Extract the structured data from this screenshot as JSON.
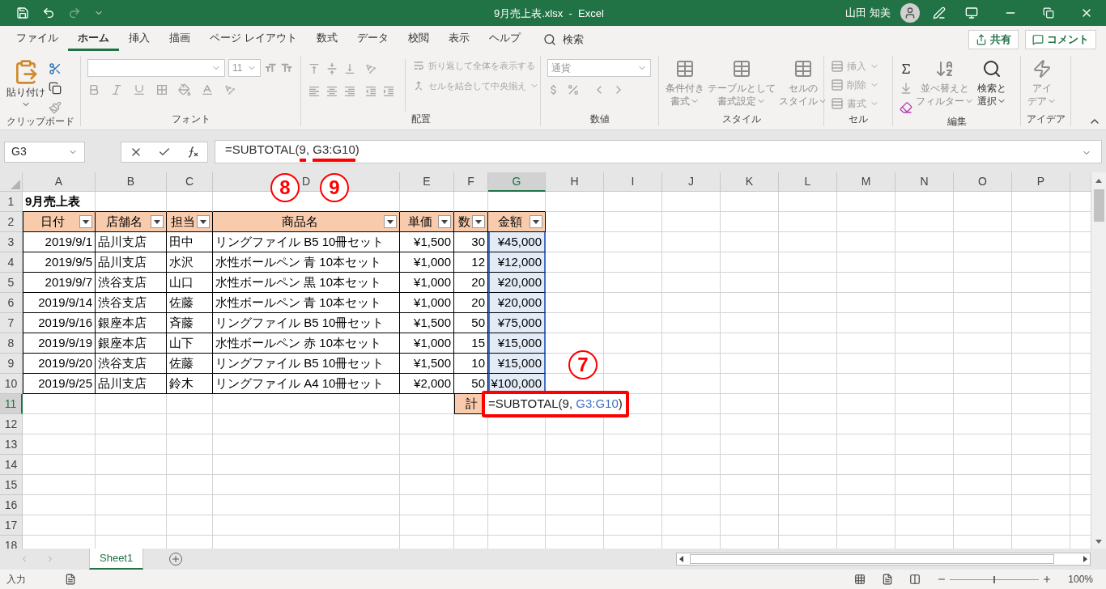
{
  "title_bar": {
    "title": "9月売上表.xlsx  -  Excel",
    "user": "山田 知美"
  },
  "menu_tabs": [
    {
      "label": "ファイル",
      "selected": false
    },
    {
      "label": "ホーム",
      "selected": true
    },
    {
      "label": "挿入",
      "selected": false
    },
    {
      "label": "描画",
      "selected": false
    },
    {
      "label": "ページ レイアウト",
      "selected": false
    },
    {
      "label": "数式",
      "selected": false
    },
    {
      "label": "データ",
      "selected": false
    },
    {
      "label": "校閲",
      "selected": false
    },
    {
      "label": "表示",
      "selected": false
    },
    {
      "label": "ヘルプ",
      "selected": false
    }
  ],
  "search": {
    "label": "検索"
  },
  "share_button": "共有",
  "comment_button": "コメント",
  "ribbon": {
    "clipboard": {
      "label": "クリップボード",
      "paste": {
        "label": "貼り付け",
        "disabled": false
      }
    },
    "font": {
      "label": "フォント",
      "font_size": "11"
    },
    "alignment": {
      "label": "配置",
      "wrap_text": {
        "label": "折り返して全体を表示する",
        "disabled": true
      },
      "merge": {
        "label": "セルを結合して中央揃え",
        "disabled": true
      }
    },
    "number": {
      "label": "数値",
      "format": "通貨"
    },
    "styles": {
      "label": "スタイル",
      "buttons": [
        {
          "lines": [
            "条件付き",
            "書式"
          ],
          "disabled": true
        },
        {
          "lines": [
            "テーブルとして",
            "書式設定"
          ],
          "disabled": true
        },
        {
          "lines": [
            "セルの",
            "スタイル"
          ],
          "disabled": true
        }
      ]
    },
    "cells": {
      "label": "セル",
      "buttons": [
        {
          "label": "挿入",
          "disabled": true
        },
        {
          "label": "削除",
          "disabled": true
        },
        {
          "label": "書式",
          "disabled": true
        }
      ]
    },
    "editing": {
      "label": "編集",
      "sort": {
        "lines": [
          "並べ替えと",
          "フィルター"
        ],
        "disabled": true
      },
      "find": {
        "lines": [
          "検索と",
          "選択"
        ],
        "disabled": false
      }
    },
    "ideas": {
      "label": "アイデア",
      "button": {
        "lines": [
          "アイ",
          "デア"
        ],
        "disabled": true
      }
    }
  },
  "formula_bar": {
    "name_box": "G3",
    "formula_parts": [
      {
        "text": "=SUBTOTAL(",
        "marked": false
      },
      {
        "text": "9",
        "marked": true
      },
      {
        "text": ", ",
        "marked": false
      },
      {
        "text": "G3:G10",
        "marked": true
      },
      {
        "text": ")",
        "marked": false
      }
    ]
  },
  "column_headers": [
    {
      "label": "A",
      "selected": false
    },
    {
      "label": "B",
      "selected": false
    },
    {
      "label": "C",
      "selected": false
    },
    {
      "label": "D",
      "selected": false
    },
    {
      "label": "E",
      "selected": false
    },
    {
      "label": "F",
      "selected": false
    },
    {
      "label": "G",
      "selected": true
    },
    {
      "label": "H",
      "selected": false
    },
    {
      "label": "I",
      "selected": false
    },
    {
      "label": "J",
      "selected": false
    },
    {
      "label": "K",
      "selected": false
    },
    {
      "label": "L",
      "selected": false
    },
    {
      "label": "M",
      "selected": false
    },
    {
      "label": "N",
      "selected": false
    },
    {
      "label": "O",
      "selected": false
    },
    {
      "label": "P",
      "selected": false
    }
  ],
  "row_headers": [
    {
      "label": "1",
      "selected": false
    },
    {
      "label": "2",
      "selected": false
    },
    {
      "label": "3",
      "selected": false
    },
    {
      "label": "4",
      "selected": false
    },
    {
      "label": "5",
      "selected": false
    },
    {
      "label": "6",
      "selected": false
    },
    {
      "label": "7",
      "selected": false
    },
    {
      "label": "8",
      "selected": false
    },
    {
      "label": "9",
      "selected": false
    },
    {
      "label": "10",
      "selected": false
    },
    {
      "label": "11",
      "selected": true
    },
    {
      "label": "12",
      "selected": false
    },
    {
      "label": "13",
      "selected": false
    },
    {
      "label": "14",
      "selected": false
    },
    {
      "label": "15",
      "selected": false
    },
    {
      "label": "16",
      "selected": false
    },
    {
      "label": "17",
      "selected": false
    },
    {
      "label": "18",
      "selected": false
    }
  ],
  "sheet_title": "9月売上表",
  "table": {
    "columns": [
      "日付",
      "店舗名",
      "担当",
      "商品名",
      "単価",
      "数",
      "金額"
    ],
    "rows": [
      [
        "2019/9/1",
        "品川支店",
        "田中",
        "リングファイル B5 10冊セット",
        "¥1,500",
        "30",
        "¥45,000"
      ],
      [
        "2019/9/5",
        "品川支店",
        "水沢",
        "水性ボールペン 青 10本セット",
        "¥1,000",
        "12",
        "¥12,000"
      ],
      [
        "2019/9/7",
        "渋谷支店",
        "山口",
        "水性ボールペン 黒 10本セット",
        "¥1,000",
        "20",
        "¥20,000"
      ],
      [
        "2019/9/14",
        "渋谷支店",
        "佐藤",
        "水性ボールペン 青 10本セット",
        "¥1,000",
        "20",
        "¥20,000"
      ],
      [
        "2019/9/16",
        "銀座本店",
        "斉藤",
        "リングファイル B5 10冊セット",
        "¥1,500",
        "50",
        "¥75,000"
      ],
      [
        "2019/9/19",
        "銀座本店",
        "山下",
        "水性ボールペン 赤 10本セット",
        "¥1,000",
        "15",
        "¥15,000"
      ],
      [
        "2019/9/20",
        "渋谷支店",
        "佐藤",
        "リングファイル B5 10冊セット",
        "¥1,500",
        "10",
        "¥15,000"
      ],
      [
        "2019/9/25",
        "品川支店",
        "鈴木",
        "リングファイル A4 10冊セット",
        "¥2,000",
        "50",
        "¥100,000"
      ]
    ]
  },
  "total": {
    "label": "計",
    "editor_parts": [
      {
        "text": "=SUBTOTAL(9, ",
        "kind": "plain"
      },
      {
        "text": "G3:G10",
        "kind": "reference"
      },
      {
        "text": ")",
        "kind": "plain"
      }
    ]
  },
  "callouts": [
    "8",
    "9",
    "7"
  ],
  "sheet_tabs": [
    {
      "label": "Sheet1",
      "selected": true
    }
  ],
  "status_bar": {
    "mode": "入力",
    "zoom_slider": {
      "level": 0.5
    },
    "zoom": "100%"
  }
}
